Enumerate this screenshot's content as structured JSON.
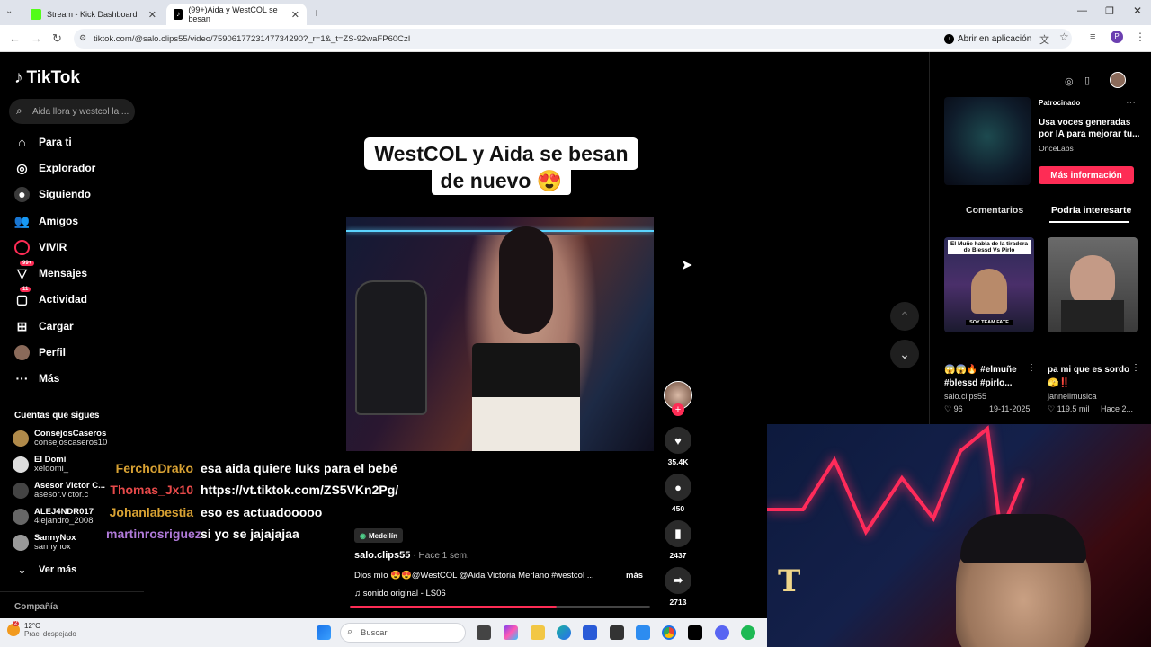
{
  "browser": {
    "tabs": [
      {
        "title": "Stream - Kick Dashboard",
        "favicon_color": "#53fc18"
      },
      {
        "title": "(99+)Aida y WestCOL se besan",
        "favicon_color": "#000000"
      }
    ],
    "url": "tiktok.com/@salo.clips55/video/7590617723147734290?_r=1&_t=ZS-92waFP60CzI",
    "open_in_app": "Abrir en aplicación",
    "profile_initial": "P"
  },
  "sidebar": {
    "logo": "TikTok",
    "search_placeholder": "Aida llora y westcol la ...",
    "nav": [
      {
        "label": "Para ti",
        "icon": "home-icon"
      },
      {
        "label": "Explorador",
        "icon": "compass-icon"
      },
      {
        "label": "Siguiendo",
        "icon": "following-icon"
      },
      {
        "label": "Amigos",
        "icon": "friends-icon"
      },
      {
        "label": "VIVIR",
        "icon": "live-icon"
      },
      {
        "label": "Mensajes",
        "icon": "messages-icon",
        "badge": "99+"
      },
      {
        "label": "Actividad",
        "icon": "activity-icon",
        "badge": "11"
      },
      {
        "label": "Cargar",
        "icon": "upload-icon"
      },
      {
        "label": "Perfil",
        "icon": "profile-icon"
      },
      {
        "label": "Más",
        "icon": "more-icon"
      }
    ],
    "following_title": "Cuentas que sigues",
    "following": [
      {
        "name": "ConsejosCaseros",
        "handle": "consejoscaseros10"
      },
      {
        "name": "El Domi",
        "handle": "xeldomi_"
      },
      {
        "name": "Asesor Victor C...",
        "handle": "asesor.victor.c"
      },
      {
        "name": "ALEJ4NDR017",
        "handle": "4lejandro_2008"
      },
      {
        "name": "SannyNox",
        "handle": "sannynox"
      }
    ],
    "see_more": "Ver más",
    "company": "Compañía"
  },
  "video": {
    "caption_line1": "WestCOL y Aida se besan",
    "caption_line2": "de nuevo 😍",
    "location": "Medellín",
    "author": "salo.clips55",
    "posted": "· Hace 1 sem.",
    "description": "Dios mío 😍😍@WestCOL @Aida Victoria Merlano  #westcol ...",
    "more": "más",
    "sound": "♫  sonido original - LS06",
    "progress": 0.69
  },
  "actions": {
    "likes": "35.4K",
    "comments": "450",
    "saves": "2437",
    "shares": "2713"
  },
  "chat": [
    {
      "user": "FerchoDrako",
      "color": "#d9a233",
      "msg": "esa aida quiere luks para el bebé"
    },
    {
      "user": "Thomas_Jx10",
      "color": "#e84a4a",
      "msg": "https://vt.tiktok.com/ZS5VKn2Pg/"
    },
    {
      "user": "Johanlabestia",
      "color": "#d9a233",
      "msg": "eso es actuadooooo"
    },
    {
      "user": "martinrosriguez",
      "color": "#b07ad9",
      "msg": "si yo se jajajajaa"
    }
  ],
  "right_panel": {
    "sponsored": "Patrocinado",
    "ad_text": "Usa voces generadas por IA para mejorar tu...",
    "ad_brand": "OnceLabs",
    "ad_button": "Más información",
    "tab_comments": "Comentarios",
    "tab_interest": "Podría interesarte",
    "videos": [
      {
        "overlay": "El Muñe habla de la tiradera de Blessd Vs Pirlo",
        "title": "😱😱🔥 #elmuñe #blessd #pirlo...",
        "author": "salo.clips55",
        "likes": "♡ 96",
        "date": "19-11-2025"
      },
      {
        "overlay": "",
        "title": "pa mi que es sordo 🫣‼️",
        "author": "jannellmusica",
        "likes": "♡ 119.5 mil",
        "date": "Hace 2..."
      }
    ],
    "thumb_badge": "SOY TEAM FATE"
  },
  "taskbar": {
    "temp": "12°C",
    "weather": "Prac. despejado",
    "weather_badge": "2",
    "search": "Buscar"
  },
  "webcam": {
    "letter": "T"
  }
}
